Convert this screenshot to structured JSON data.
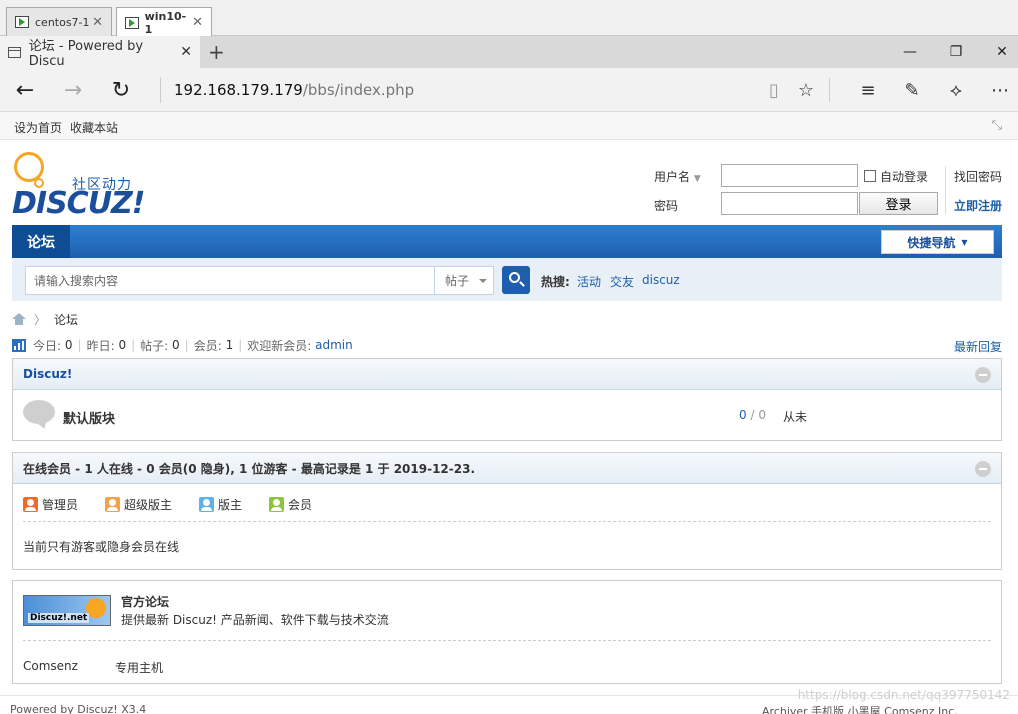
{
  "vm_tabs": [
    {
      "label": "centos7-1",
      "active": false
    },
    {
      "label": "win10-1",
      "active": true
    }
  ],
  "browser": {
    "tab_title": "论坛 - Powered by Discu",
    "address_host": "192.168.179.179",
    "address_path": "/bbs/index.php"
  },
  "topnav": {
    "set_home": "设为首页",
    "bookmark": "收藏本站"
  },
  "logo": {
    "tagline": "社区动力",
    "wordmark": "DISCUZ!"
  },
  "login": {
    "username_label": "用户名",
    "password_label": "密码",
    "auto_login": "自动登录",
    "login_button": "登录",
    "find_password": "找回密码",
    "register": "立即注册"
  },
  "navbar": {
    "current": "论坛",
    "quick_nav": "快捷导航"
  },
  "search": {
    "placeholder": "请输入搜索内容",
    "type": "帖子",
    "hot_label": "热搜:",
    "hot_terms": [
      "活动",
      "交友",
      "discuz"
    ]
  },
  "breadcrumb": {
    "current": "论坛"
  },
  "stats": {
    "today_label": "今日:",
    "today": "0",
    "yesterday_label": "昨日:",
    "yesterday": "0",
    "posts_label": "帖子:",
    "posts": "0",
    "members_label": "会员:",
    "members": "1",
    "welcome_label": "欢迎新会员:",
    "newest": "admin",
    "latest_replies": "最新回复"
  },
  "forum_group": {
    "title": "Discuz!",
    "forums": [
      {
        "name": "默认版块",
        "threads": "0",
        "posts": "0",
        "last": "从未"
      }
    ]
  },
  "online": {
    "title": "在线会员 - 1 人在线 - 0 会员(0 隐身), 1 位游客 - 最高记录是 1 于 2019-12-23.",
    "legend": [
      {
        "label": "管理员",
        "color": "#f06a2a"
      },
      {
        "label": "超级版主",
        "color": "#f5a04a"
      },
      {
        "label": "版主",
        "color": "#5cb3e6"
      },
      {
        "label": "会员",
        "color": "#8cc43c"
      }
    ],
    "note": "当前只有游客或隐身会员在线"
  },
  "partner": {
    "badge": "Discuz!.net",
    "title": "官方论坛",
    "desc": "提供最新 Discuz! 产品新闻、软件下载与技术交流",
    "links": [
      "Comsenz",
      "专用主机"
    ]
  },
  "footer": {
    "left": "Powered by Discuz! X3.4",
    "right": "Archiver 手机版 小黑屋 Comsenz Inc."
  },
  "watermark": "https://blog.csdn.net/qq397750142"
}
